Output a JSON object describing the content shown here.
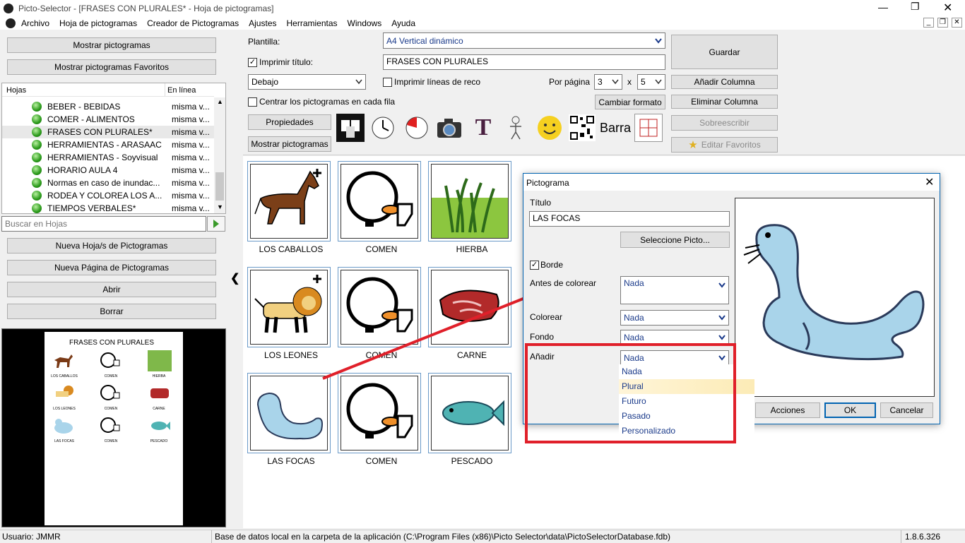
{
  "window": {
    "title": "Picto-Selector - [FRASES CON PLURALES* - Hoja de pictogramas]"
  },
  "menu": [
    "Archivo",
    "Hoja de pictogramas",
    "Creador de Pictogramas",
    "Ajustes",
    "Herramientas",
    "Windows",
    "Ayuda"
  ],
  "left": {
    "show_picto": "Mostrar pictogramas",
    "show_fav": "Mostrar pictogramas Favoritos",
    "col_hojas": "Hojas",
    "col_online": "En línea",
    "sheets": [
      {
        "name": "BEBER - BEBIDAS",
        "online": "misma v..."
      },
      {
        "name": "COMER - ALIMENTOS",
        "online": "misma v..."
      },
      {
        "name": "FRASES CON PLURALES*",
        "online": "misma v..."
      },
      {
        "name": "HERRAMIENTAS - ARASAAC",
        "online": "misma v..."
      },
      {
        "name": "HERRAMIENTAS - Soyvisual",
        "online": "misma v..."
      },
      {
        "name": "HORARIO AULA 4",
        "online": "misma v..."
      },
      {
        "name": "Normas en caso de inundac...",
        "online": "misma v..."
      },
      {
        "name": "RODEA Y COLOREA LOS A...",
        "online": "misma v..."
      },
      {
        "name": "TIEMPOS VERBALES*",
        "online": "misma v..."
      }
    ],
    "search_placeholder": "Buscar en Hojas",
    "new_sheet": "Nueva Hoja/s de Pictogramas",
    "new_page": "Nueva Página de Pictogramas",
    "open": "Abrir",
    "delete": "Borrar",
    "preview_title": "FRASES CON PLURALES",
    "preview_labels": [
      "LOS CABALLOS",
      "COMEN",
      "HIERBA",
      "LOS LEONES",
      "COMEN",
      "CARNE",
      "LAS FOCAS",
      "COMEN",
      "PESCADO"
    ]
  },
  "toolbar": {
    "plantilla_label": "Plantilla:",
    "plantilla_value": "A4 Vertical dinámico",
    "print_title_label": "Imprimir título:",
    "title_value": "FRASES CON PLURALES",
    "position_value": "Debajo",
    "print_lines_label": "Imprimir líneas de reco",
    "per_page_label": "Por página",
    "per_page_cols": "3",
    "per_page_x": "x",
    "per_page_rows": "5",
    "center_label": "Centrar los pictogramas en cada fila",
    "change_format": "Cambiar formato",
    "properties": "Propiedades",
    "show_picto": "Mostrar pictogramas",
    "save": "Guardar",
    "add_column": "Añadir Columna",
    "remove_column": "Eliminar Columna",
    "overwrite": "Sobreescribir",
    "edit_favorites": "Editar Favoritos",
    "tool_text": "Barra",
    "tool_letter": "T"
  },
  "grid": {
    "labels": [
      "LOS CABALLOS",
      "COMEN",
      "HIERBA",
      "LOS LEONES",
      "COMEN",
      "CARNE",
      "LAS FOCAS",
      "COMEN",
      "PESCADO"
    ]
  },
  "dialog": {
    "title": "Pictograma",
    "titulo_label": "Título",
    "titulo_value": "LAS FOCAS",
    "select_picto": "Seleccione Picto...",
    "border_label": "Borde",
    "before_color_label": "Antes de colorear",
    "before_color_value": "Nada",
    "color_label": "Colorear",
    "color_value": "Nada",
    "background_label": "Fondo",
    "background_value": "Nada",
    "add_label": "Añadir",
    "add_value": "Nada",
    "add_options": [
      "Nada",
      "Plural",
      "Futuro",
      "Pasado",
      "Personalizado"
    ],
    "actions": "Acciones",
    "ok": "OK",
    "cancel": "Cancelar"
  },
  "status": {
    "user": "Usuario: JMMR",
    "db": "Base de datos local en la carpeta de la aplicación (C:\\Program Files (x86)\\Picto Selector\\data\\PictoSelectorDatabase.fdb)",
    "version": "1.8.6.326"
  },
  "colors": {
    "accent": "#0063b1",
    "highlight": "#fcebb6",
    "annotation": "#e0202a",
    "seal": "#a9d4ea"
  }
}
